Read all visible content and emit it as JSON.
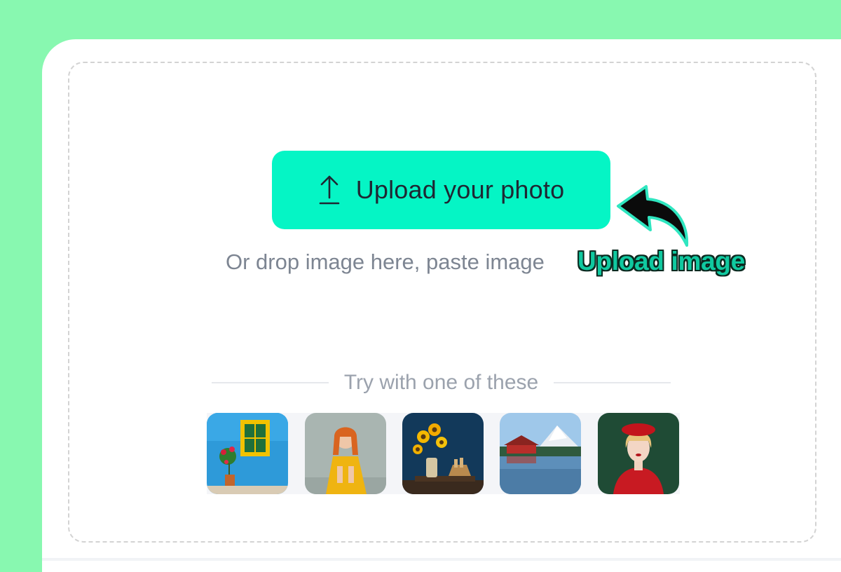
{
  "upload": {
    "button_label": "Upload your photo",
    "button_icon": "upload-arrow-icon",
    "hint": "Or drop image here, paste image"
  },
  "annotation": {
    "label": "Upload image",
    "icon": "curved-arrow-icon"
  },
  "samples": {
    "heading": "Try with one of these",
    "items": [
      {
        "subject": "blue-wall-yellow-window"
      },
      {
        "subject": "girl-in-yellow-dress"
      },
      {
        "subject": "sunflowers-vase"
      },
      {
        "subject": "lake-lodge-mountains"
      },
      {
        "subject": "woman-red-beret"
      }
    ]
  },
  "colors": {
    "page_background": "#88f8b0",
    "accent": "#05f5c5",
    "annotation_text": "#10c9a0",
    "hint_text": "#7d8592"
  }
}
